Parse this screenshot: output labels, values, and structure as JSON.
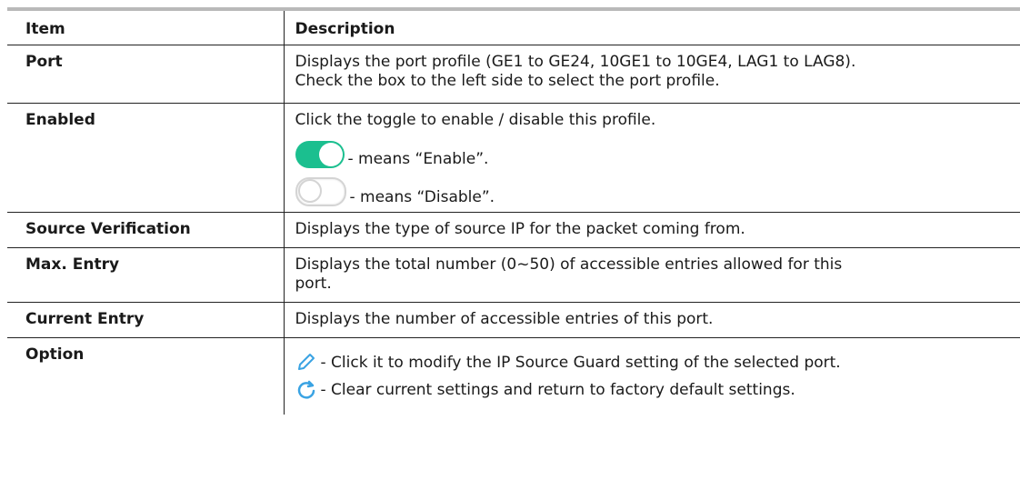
{
  "header": {
    "item": "Item",
    "description": "Description"
  },
  "rows": [
    {
      "item": "Port",
      "lines": [
        "Displays the port profile (GE1 to GE24, 10GE1 to 10GE4, LAG1 to LAG8).",
        "Check the box to the left side to select the port profile."
      ]
    },
    {
      "item": "Enabled",
      "lines": [
        "Click the toggle to enable / disable this profile."
      ],
      "toggles": [
        {
          "state": "on",
          "text": "- means “Enable”."
        },
        {
          "state": "off",
          "text": "- means “Disable”."
        }
      ]
    },
    {
      "item": "Source Verification",
      "lines": [
        "Displays the type of source IP for the packet coming from."
      ]
    },
    {
      "item": "Max. Entry",
      "lines": [
        "Displays the total number (0~50) of accessible entries allowed for this",
        "port."
      ]
    },
    {
      "item": "Current Entry",
      "lines": [
        "Displays the number of accessible entries of this port."
      ]
    },
    {
      "item": "Option",
      "options": [
        {
          "icon": "pencil-icon",
          "text": "- Click it to modify the IP Source Guard setting of the selected port."
        },
        {
          "icon": "refresh-icon",
          "text": "- Clear current settings and return to factory default settings."
        }
      ]
    }
  ],
  "colors": {
    "toggle_on": "#1bbf8f",
    "icon_blue": "#3aa3e3"
  }
}
